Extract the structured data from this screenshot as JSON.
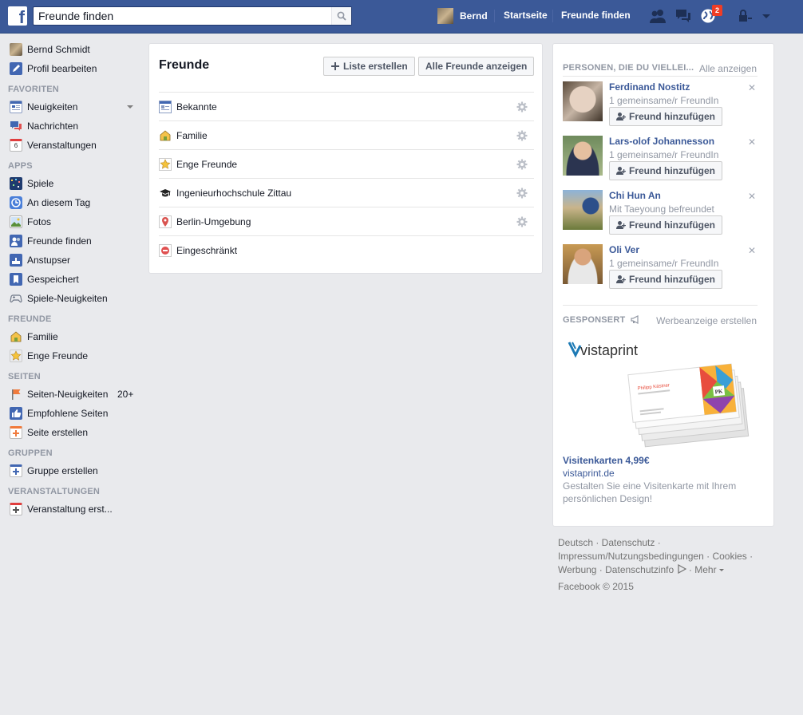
{
  "topbar": {
    "logo": "f",
    "search_placeholder": "Freunde finden",
    "user_name": "Bernd",
    "nav_home": "Startseite",
    "nav_find_friends": "Freunde finden",
    "notification_count": "2",
    "colors": {
      "brand": "#3b5998",
      "badge": "#f03d25"
    }
  },
  "sidebar": {
    "profile_name": "Bernd Schmidt",
    "edit_profile": "Profil bearbeiten",
    "sections": [
      {
        "title": "FAVORITEN",
        "items": [
          {
            "label": "Neuigkeiten",
            "icon": "news-feed-icon"
          },
          {
            "label": "Nachrichten",
            "icon": "messages-icon"
          },
          {
            "label": "Veranstaltungen",
            "icon": "calendar-icon",
            "icon_text": "6"
          }
        ]
      },
      {
        "title": "APPS",
        "items": [
          {
            "label": "Spiele",
            "icon": "games-icon"
          },
          {
            "label": "An diesem Tag",
            "icon": "on-this-day-icon"
          },
          {
            "label": "Fotos",
            "icon": "photos-icon"
          },
          {
            "label": "Freunde finden",
            "icon": "find-friends-icon"
          },
          {
            "label": "Anstupser",
            "icon": "poke-icon"
          },
          {
            "label": "Gespeichert",
            "icon": "saved-icon"
          },
          {
            "label": "Spiele-Neuigkeiten",
            "icon": "game-feed-icon"
          }
        ]
      },
      {
        "title": "FREUNDE",
        "items": [
          {
            "label": "Familie",
            "icon": "family-house-icon"
          },
          {
            "label": "Enge Freunde",
            "icon": "close-friends-star-icon"
          }
        ]
      },
      {
        "title": "SEITEN",
        "items": [
          {
            "label": "Seiten-Neuigkeiten",
            "icon": "pages-feed-flag-icon",
            "count": "20+"
          },
          {
            "label": "Empfohlene Seiten",
            "icon": "like-thumb-icon"
          },
          {
            "label": "Seite erstellen",
            "icon": "create-page-icon"
          }
        ]
      },
      {
        "title": "GRUPPEN",
        "items": [
          {
            "label": "Gruppe erstellen",
            "icon": "create-group-icon"
          }
        ]
      },
      {
        "title": "VERANSTALTUNGEN",
        "items": [
          {
            "label": "Veranstaltung erst...",
            "icon": "create-event-icon"
          }
        ]
      }
    ]
  },
  "friends": {
    "title": "Freunde",
    "create_list": "Liste erstellen",
    "show_all": "Alle Freunde anzeigen",
    "lists": [
      {
        "label": "Bekannte",
        "icon": "acquaintances-icon",
        "settings": true
      },
      {
        "label": "Familie",
        "icon": "family-house-icon",
        "settings": true
      },
      {
        "label": "Enge Freunde",
        "icon": "close-friends-star-icon",
        "settings": true
      },
      {
        "label": "Ingenieurhochschule Zittau",
        "icon": "school-cap-icon",
        "settings": true
      },
      {
        "label": "Berlin-Umgebung",
        "icon": "location-pin-icon",
        "settings": true
      },
      {
        "label": "Eingeschränkt",
        "icon": "restricted-icon",
        "settings": false
      }
    ]
  },
  "pymk": {
    "title": "PERSONEN, DIE DU VIELLEI...",
    "see_all": "Alle anzeigen",
    "add_label": "Freund hinzufügen",
    "people": [
      {
        "name": "Ferdinand Nostitz",
        "sub": "1 gemeinsame/r FreundIn"
      },
      {
        "name": "Lars-olof Johannesson",
        "sub": "1 gemeinsame/r FreundIn"
      },
      {
        "name": "Chi Hun An",
        "sub": "Mit Taeyoung befreundet"
      },
      {
        "name": "Oli Ver",
        "sub": "1 gemeinsame/r FreundIn"
      }
    ]
  },
  "ad": {
    "sponsored": "GESPONSERT",
    "create_ad": "Werbeanzeige erstellen",
    "brand": "vistaprint",
    "card_name": "Philipp Kästner",
    "card_initials": "PK",
    "title": "Visitenkarten 4,99€",
    "domain": "vistaprint.de",
    "description": "Gestalten Sie eine Visitenkarte mit Ihrem persönlichen Design!"
  },
  "footer": {
    "line1": "Deutsch · Datenschutz ·",
    "line2": "Impressum/Nutzungsbedingungen · Cookies ·",
    "line3a": "Werbung · Datenschutzinfo",
    "line3b": " · Mehr",
    "copyright": "Facebook © 2015"
  }
}
